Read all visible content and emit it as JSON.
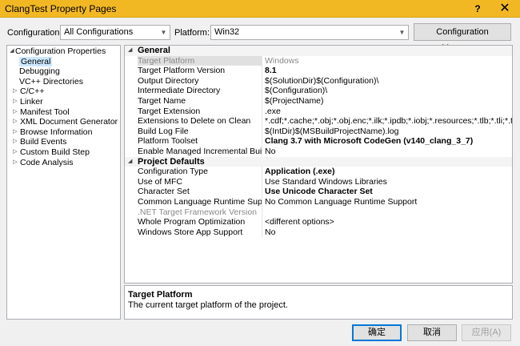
{
  "window": {
    "title": "ClangTest Property Pages",
    "help_glyph": "?",
    "close_glyph": "✕"
  },
  "config_bar": {
    "configuration_label": "Configuration:",
    "configuration_value": "All Configurations",
    "platform_label": "Platform:",
    "platform_value": "Win32",
    "manager_button": "Configuration Manager..."
  },
  "tree": {
    "items": [
      {
        "label": "Configuration Properties",
        "expander": "◢"
      },
      {
        "label": "General",
        "expander": "",
        "selected": true
      },
      {
        "label": "Debugging",
        "expander": ""
      },
      {
        "label": "VC++ Directories",
        "expander": ""
      },
      {
        "label": "C/C++",
        "expander": "▷"
      },
      {
        "label": "Linker",
        "expander": "▷"
      },
      {
        "label": "Manifest Tool",
        "expander": "▷"
      },
      {
        "label": "XML Document Generator",
        "expander": "▷"
      },
      {
        "label": "Browse Information",
        "expander": "▷"
      },
      {
        "label": "Build Events",
        "expander": "▷"
      },
      {
        "label": "Custom Build Step",
        "expander": "▷"
      },
      {
        "label": "Code Analysis",
        "expander": "▷"
      }
    ]
  },
  "grid": {
    "categories": [
      {
        "name": "General",
        "expander": "◢",
        "rows": [
          {
            "name": "Target Platform",
            "value": "Windows"
          },
          {
            "name": "Target Platform Version",
            "value": "8.1"
          },
          {
            "name": "Output Directory",
            "value": "$(SolutionDir)$(Configuration)\\"
          },
          {
            "name": "Intermediate Directory",
            "value": "$(Configuration)\\"
          },
          {
            "name": "Target Name",
            "value": "$(ProjectName)"
          },
          {
            "name": "Target Extension",
            "value": ".exe"
          },
          {
            "name": "Extensions to Delete on Clean",
            "value": "*.cdf;*.cache;*.obj;*.obj.enc;*.ilk;*.ipdb;*.iobj;*.resources;*.tlb;*.tli;*.tlh;*.tmp"
          },
          {
            "name": "Build Log File",
            "value": "$(IntDir)$(MSBuildProjectName).log"
          },
          {
            "name": "Platform Toolset",
            "value": "Clang 3.7 with Microsoft CodeGen (v140_clang_3_7)"
          },
          {
            "name": "Enable Managed Incremental Build",
            "value": "No"
          }
        ]
      },
      {
        "name": "Project Defaults",
        "expander": "◢",
        "rows": [
          {
            "name": "Configuration Type",
            "value": "Application (.exe)"
          },
          {
            "name": "Use of MFC",
            "value": "Use Standard Windows Libraries"
          },
          {
            "name": "Character Set",
            "value": "Use Unicode Character Set"
          },
          {
            "name": "Common Language Runtime Support",
            "value": "No Common Language Runtime Support"
          },
          {
            "name": ".NET Target Framework Version",
            "value": ""
          },
          {
            "name": "Whole Program Optimization",
            "value": "<different options>"
          },
          {
            "name": "Windows Store App Support",
            "value": "No"
          }
        ]
      }
    ]
  },
  "description": {
    "title": "Target Platform",
    "text": "The current target platform of the project."
  },
  "buttons": {
    "ok": "确定",
    "cancel": "取消",
    "apply": "应用(A)"
  },
  "colors": {
    "titlebar": "#f2b824",
    "selection": "#cde8ff",
    "ok_border": "#0078d7"
  }
}
